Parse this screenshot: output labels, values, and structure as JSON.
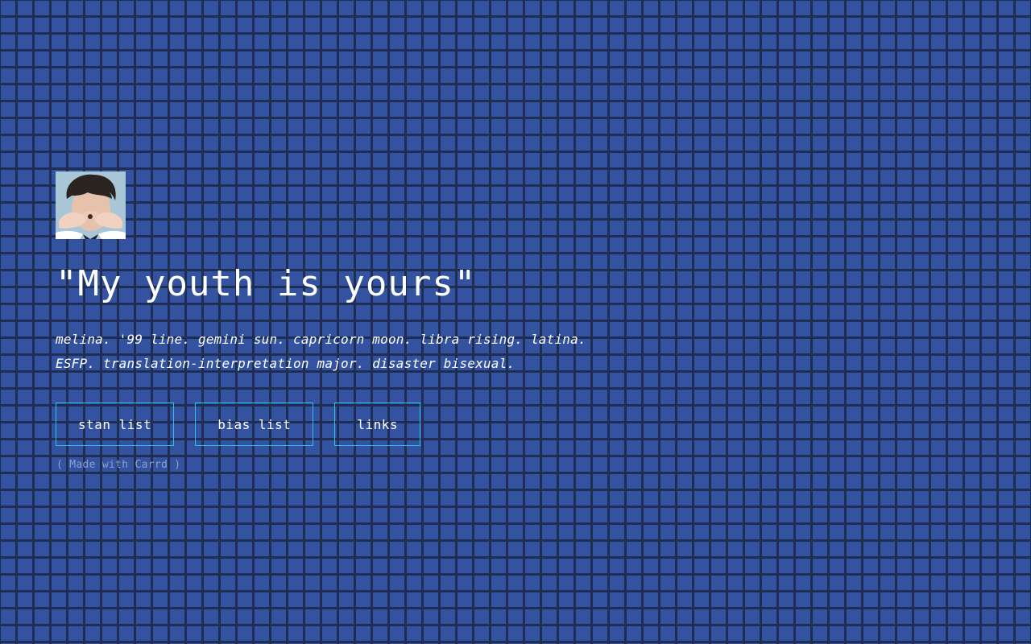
{
  "header": {
    "title": "\"My youth is yours\""
  },
  "bio": {
    "line1": "melina. '99 line. gemini sun. capricorn moon. libra rising. latina.",
    "line2": "ESFP. translation-interpretation major. disaster bisexual."
  },
  "buttons": [
    {
      "label": "stan list"
    },
    {
      "label": "bias list"
    },
    {
      "label": "links"
    }
  ],
  "footer": {
    "credit": "( Made with Carrd )"
  },
  "colors": {
    "background": "#3352a0",
    "grid_lines": "#1f2d52",
    "button_border": "#29c3e6",
    "text": "#ffffff",
    "credit_text": "#8e9fcb"
  }
}
